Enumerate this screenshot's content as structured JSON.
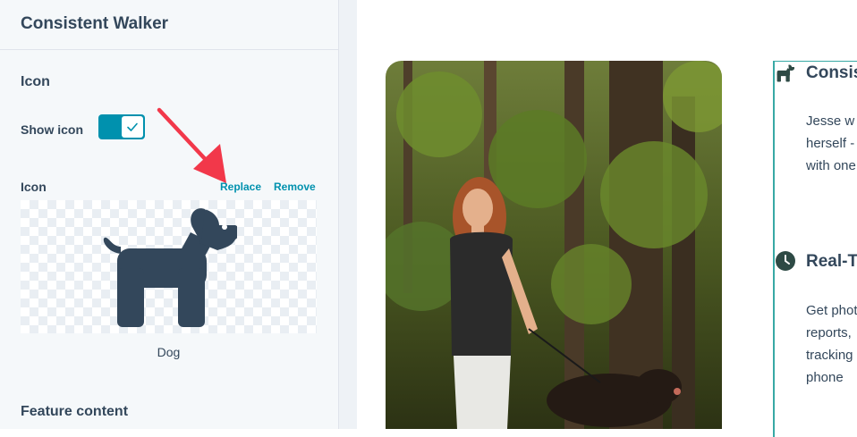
{
  "sidebar": {
    "title": "Consistent Walker",
    "icon_section_title": "Icon",
    "show_icon_label": "Show icon",
    "show_icon_enabled": true,
    "icon_field_label": "Icon",
    "replace_label": "Replace",
    "remove_label": "Remove",
    "icon_name": "Dog",
    "icon_semantic": "dog-icon",
    "feature_content_title": "Feature content"
  },
  "preview": {
    "feature1": {
      "title": "Consis",
      "icon": "dog-icon",
      "text": "Jesse w\nherself -\nwith one"
    },
    "feature2": {
      "title": "Real-T",
      "icon": "clock-icon",
      "text": "Get phot\nreports,\ntracking\nphone"
    }
  },
  "colors": {
    "accent": "#0091ae",
    "text": "#33475b",
    "border": "#38a9a5",
    "icon": "#2e4a45",
    "arrow": "#f2384a"
  }
}
